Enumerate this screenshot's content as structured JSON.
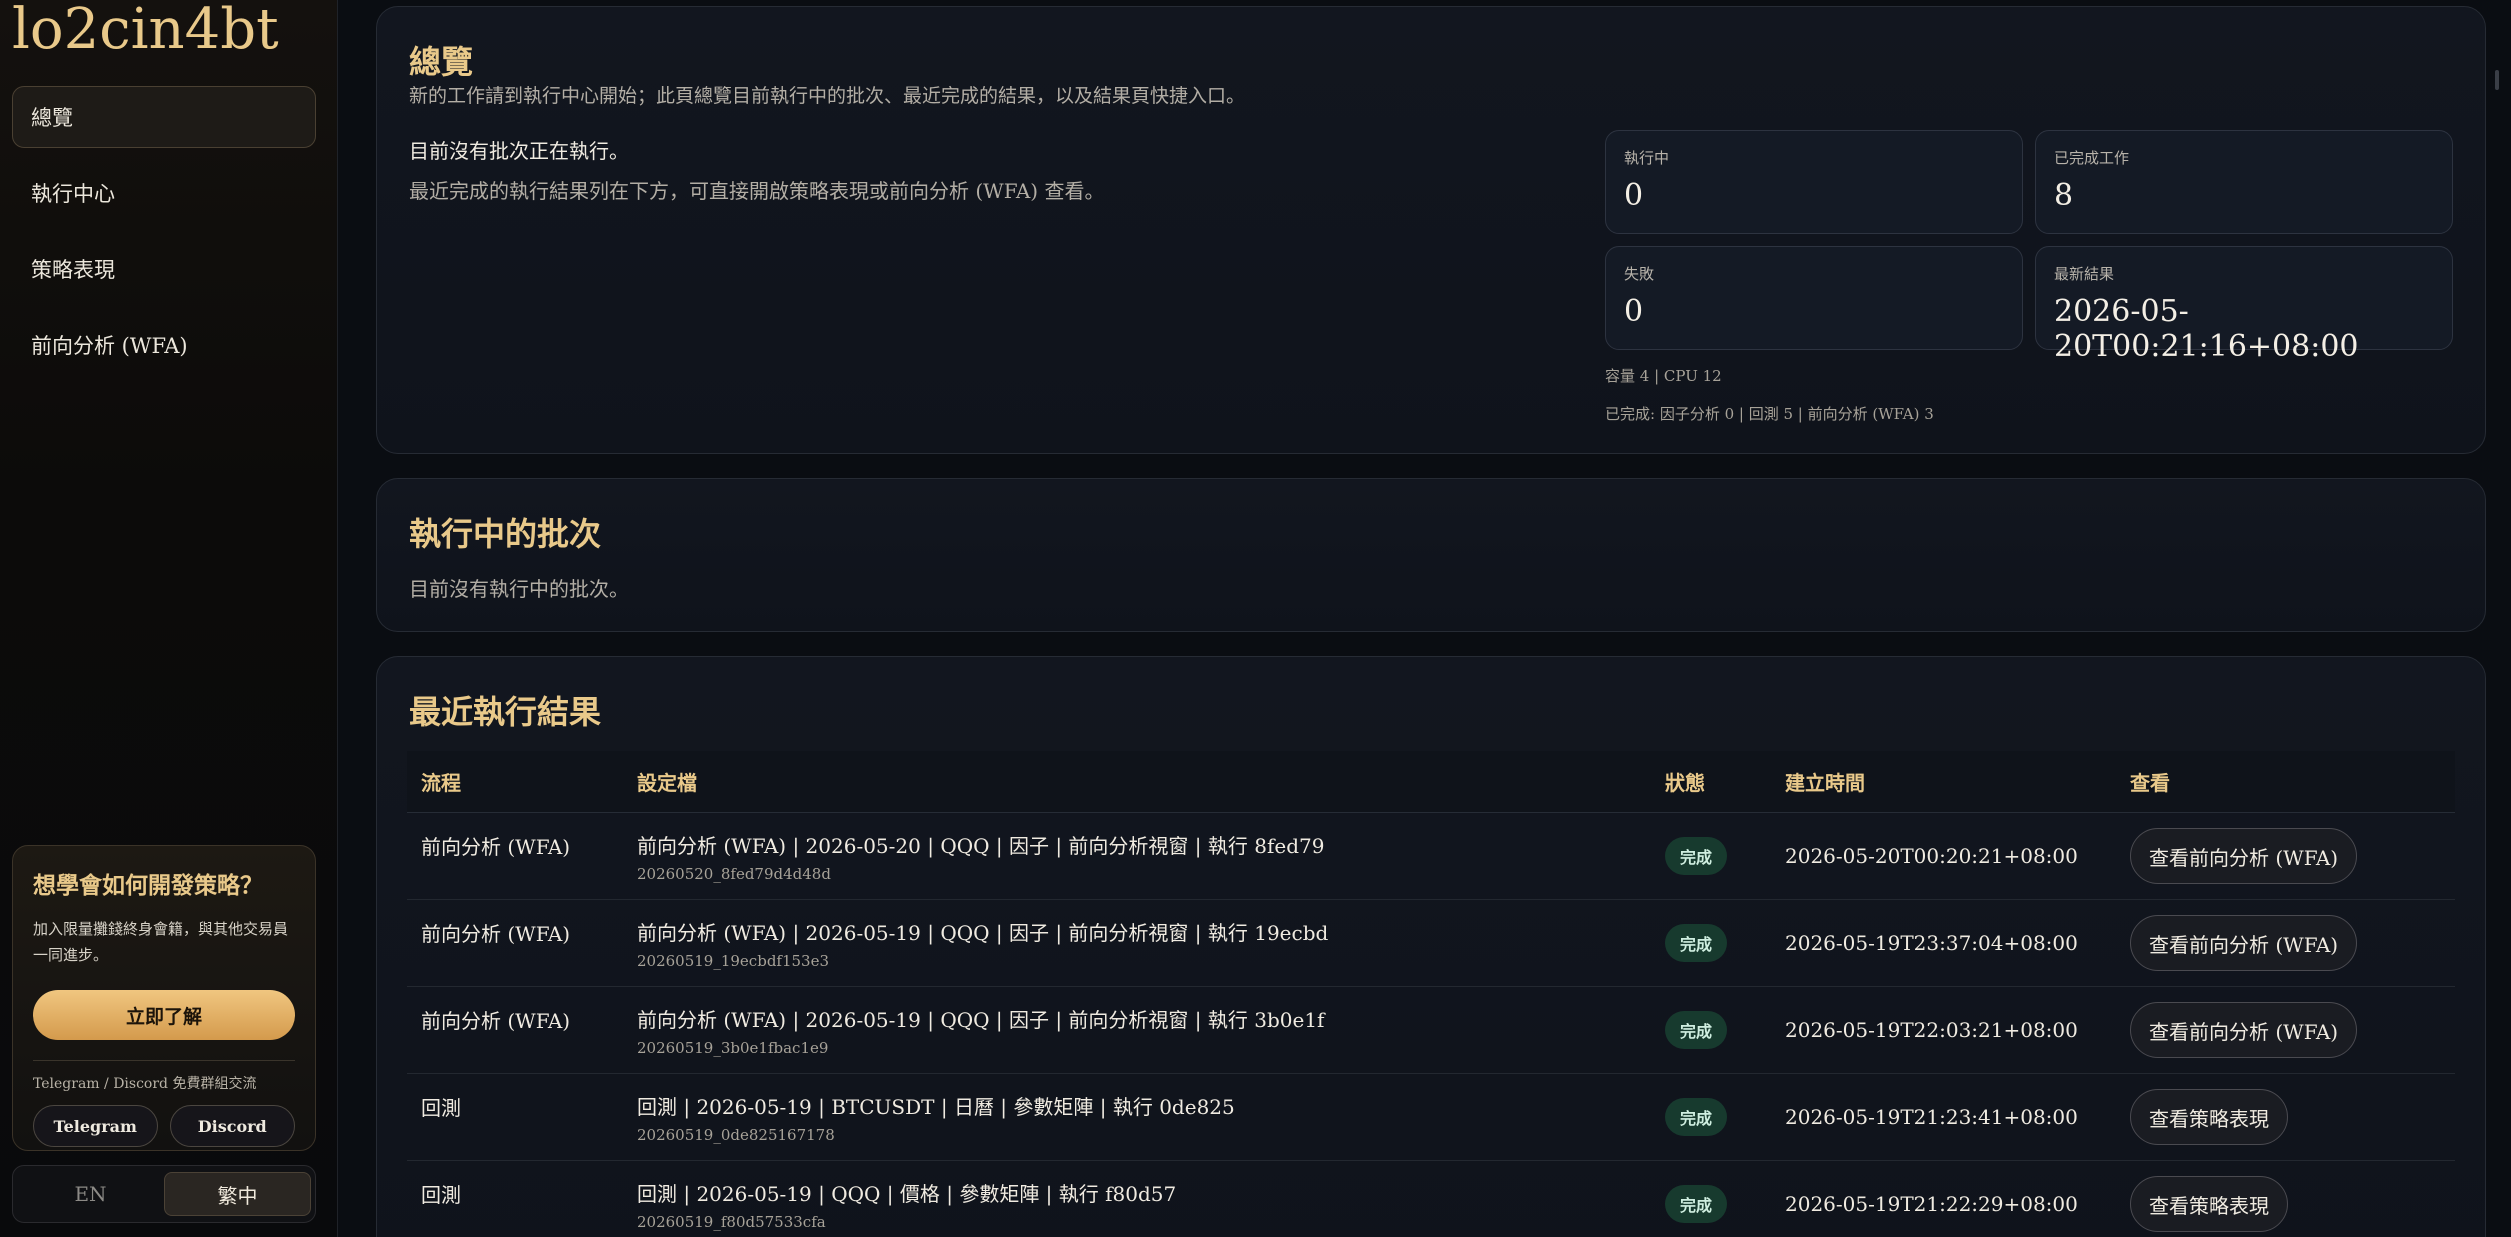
{
  "brand": "lo2cin4bt",
  "nav": [
    {
      "label": "總覽",
      "active": true
    },
    {
      "label": "執行中心",
      "active": false
    },
    {
      "label": "策略表現",
      "active": false
    },
    {
      "label": "前向分析 (WFA)",
      "active": false
    }
  ],
  "promo": {
    "title": "想學會如何開發策略？",
    "desc": "加入限量攤錢終身會籍，與其他交易員一同進步。",
    "cta": "立即了解",
    "community": "Telegram / Discord 免費群組交流",
    "telegram": "Telegram",
    "discord": "Discord"
  },
  "lang": {
    "en": "EN",
    "zh": "繁中"
  },
  "overview": {
    "title": "總覽",
    "subtitle": "新的工作請到執行中心開始；此頁總覽目前執行中的批次、最近完成的結果，以及結果頁快捷入口。",
    "status_main": "目前沒有批次正在執行。",
    "status_sub": "最近完成的執行結果列在下方，可直接開啟策略表現或前向分析 (WFA) 查看。",
    "stats": {
      "running_label": "執行中",
      "running_value": "0",
      "done_label": "已完成工作",
      "done_value": "8",
      "failed_label": "失敗",
      "failed_value": "0",
      "latest_label": "最新結果",
      "latest_value": "2026-05-20T00:21:16+08:00"
    },
    "capacity": "容量 4 | CPU 12",
    "completed": "已完成: 因子分析 0 | 回測 5 | 前向分析 (WFA) 3"
  },
  "running": {
    "title": "執行中的批次",
    "empty": "目前沒有執行中的批次。"
  },
  "recent": {
    "title": "最近執行結果",
    "headers": {
      "flow": "流程",
      "config": "設定檔",
      "status": "狀態",
      "created": "建立時間",
      "view": "查看"
    },
    "rows": [
      {
        "flow": "前向分析 (WFA)",
        "config": "前向分析 (WFA) | 2026-05-20 | QQQ | 因子 | 前向分析視窗 | 執行 8fed79",
        "id": "20260520_8fed79d4d48d",
        "status": "完成",
        "created": "2026-05-20T00:20:21+08:00",
        "view": "查看前向分析 (WFA)"
      },
      {
        "flow": "前向分析 (WFA)",
        "config": "前向分析 (WFA) | 2026-05-19 | QQQ | 因子 | 前向分析視窗 | 執行 19ecbd",
        "id": "20260519_19ecbdf153e3",
        "status": "完成",
        "created": "2026-05-19T23:37:04+08:00",
        "view": "查看前向分析 (WFA)"
      },
      {
        "flow": "前向分析 (WFA)",
        "config": "前向分析 (WFA) | 2026-05-19 | QQQ | 因子 | 前向分析視窗 | 執行 3b0e1f",
        "id": "20260519_3b0e1fbac1e9",
        "status": "完成",
        "created": "2026-05-19T22:03:21+08:00",
        "view": "查看前向分析 (WFA)"
      },
      {
        "flow": "回測",
        "config": "回測 | 2026-05-19 | BTCUSDT | 日曆 | 參數矩陣 | 執行 0de825",
        "id": "20260519_0de825167178",
        "status": "完成",
        "created": "2026-05-19T21:23:41+08:00",
        "view": "查看策略表現"
      },
      {
        "flow": "回測",
        "config": "回測 | 2026-05-19 | QQQ | 價格 | 參數矩陣 | 執行 f80d57",
        "id": "20260519_f80d57533cfa",
        "status": "完成",
        "created": "2026-05-19T21:22:29+08:00",
        "view": "查看策略表現"
      }
    ]
  }
}
